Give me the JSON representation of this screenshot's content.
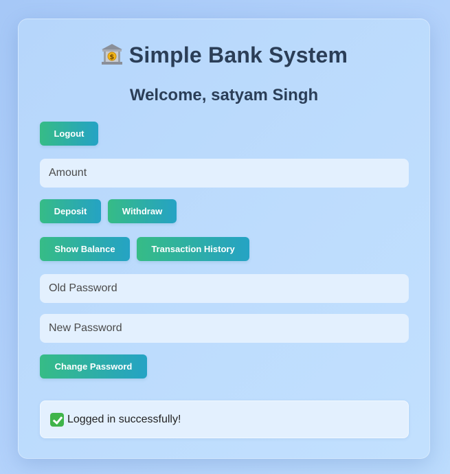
{
  "app": {
    "title": "Simple Bank System",
    "welcome": "Welcome, satyam Singh"
  },
  "buttons": {
    "logout": "Logout",
    "deposit": "Deposit",
    "withdraw": "Withdraw",
    "show_balance": "Show Balance",
    "transaction_history": "Transaction History",
    "change_password": "Change Password"
  },
  "inputs": {
    "amount": {
      "placeholder": "Amount",
      "value": ""
    },
    "old_password": {
      "placeholder": "Old Password",
      "value": ""
    },
    "new_password": {
      "placeholder": "New Password",
      "value": ""
    }
  },
  "status": {
    "message": "Logged in successfully!",
    "icon": "check-mark-icon"
  },
  "icons": {
    "title": "bank-icon"
  },
  "colors": {
    "button_gradient_start": "#36bc86",
    "button_gradient_end": "#25a3c4",
    "heading": "#2b3e57",
    "success": "#3fb44a"
  }
}
